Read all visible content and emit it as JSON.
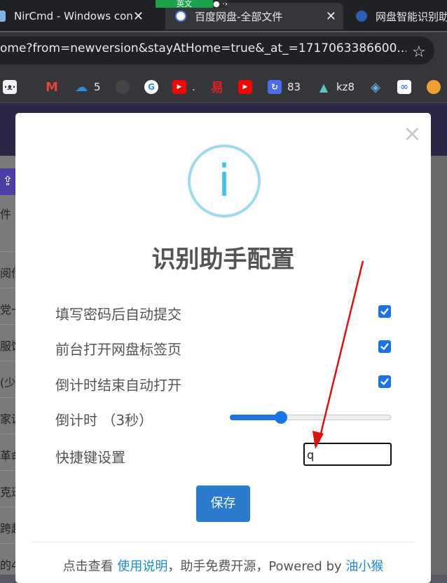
{
  "browser": {
    "tabs": [
      {
        "title": "NirCmd - Windows con",
        "active": false
      },
      {
        "title": "百度网盘-全部文件",
        "active": true
      },
      {
        "title": "网盘智能识别助",
        "active": false
      }
    ],
    "ime_indicator": "英文",
    "url": "ome?from=newversion&stayAtHome=true&_at_=1717063386600...",
    "bookmarks": [
      {
        "icon": "cat-icon",
        "label": ""
      },
      {
        "icon": "gmail-icon",
        "label": ""
      },
      {
        "icon": "onedrive-icon",
        "label": "5"
      },
      {
        "icon": "github-icon",
        "label": ""
      },
      {
        "icon": "google-icon",
        "label": ""
      },
      {
        "icon": "youtube-icon",
        "label": "."
      },
      {
        "icon": "red-glyph-icon",
        "label": ""
      },
      {
        "icon": "youtube-icon",
        "label": ""
      },
      {
        "icon": "refresh-app-icon",
        "label": "83"
      },
      {
        "icon": "mountain-icon",
        "label": "kz8"
      },
      {
        "icon": "cube-icon",
        "label": ""
      },
      {
        "icon": "baidu-netdisk-icon",
        "label": ""
      },
      {
        "icon": "orange-icon",
        "label": ""
      }
    ]
  },
  "background_page": {
    "left_snippets": [
      "件 >",
      "阅传",
      "党一",
      "服饰",
      "(少",
      "家训",
      "革命",
      "克逊",
      "跨越",
      "的4"
    ]
  },
  "dialog": {
    "title": "识别助手配置",
    "options": [
      {
        "label": "填写密码后自动提交",
        "checked": true
      },
      {
        "label": "前台打开网盘标签页",
        "checked": true
      },
      {
        "label": "倒计时结束自动打开",
        "checked": true
      }
    ],
    "countdown": {
      "label": "倒计时 （3秒）",
      "value": 3,
      "level": 0.3
    },
    "hotkey": {
      "label": "快捷键设置",
      "value": "q"
    },
    "save_label": "保存",
    "footer": {
      "prefix": "点击查看 ",
      "link1": "使用说明",
      "middle": "，助手免费开源，Powered by ",
      "link2": "油小猴"
    }
  },
  "colors": {
    "accent": "#1a73e8",
    "save_button": "#2b7ccf",
    "info_icon": "#3fc3ee",
    "annotation_arrow": "#e01010"
  }
}
